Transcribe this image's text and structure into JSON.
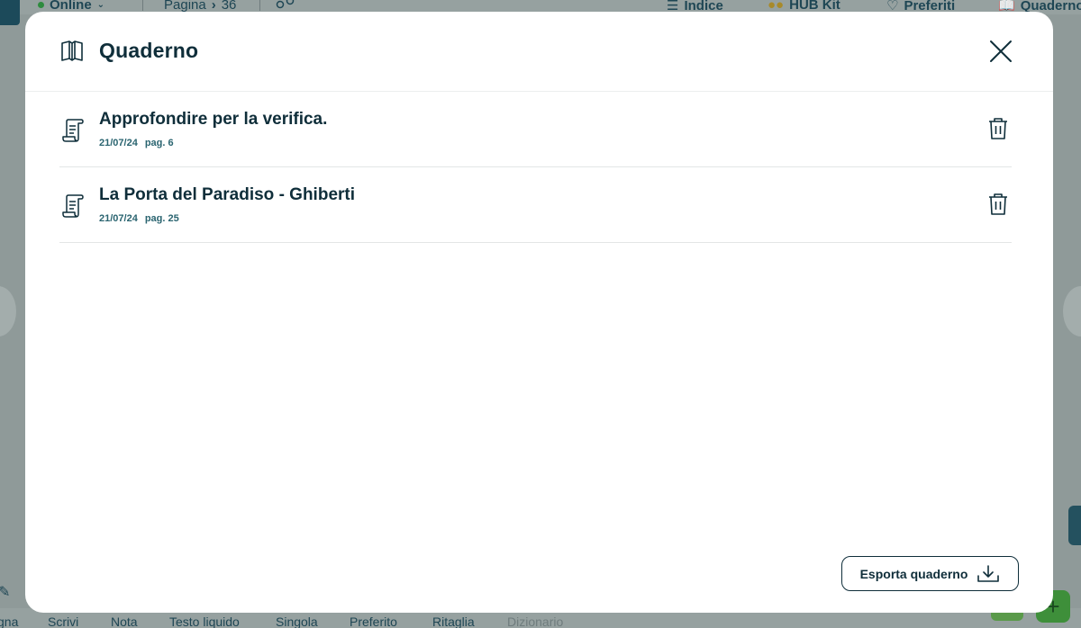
{
  "background": {
    "topbar": {
      "status": "Online",
      "page_label": "Pagina",
      "page_number": "36",
      "index_label": "Indice",
      "hubkit_label": "HUB Kit",
      "favorites_label": "Preferiti",
      "notebook_label": "Quaderno"
    },
    "bottombar": {
      "items": [
        "gna",
        "Scrivi",
        "Nota",
        "Testo liquido",
        "Singola",
        "Preferito",
        "Ritaglia",
        "Dizionario"
      ]
    }
  },
  "modal": {
    "title": "Quaderno",
    "notes": [
      {
        "title": "Approfondire per la verifica.",
        "date": "21/07/24",
        "page": "pag. 6"
      },
      {
        "title": "La Porta del Paradiso - Ghiberti",
        "date": "21/07/24",
        "page": "pag. 25"
      }
    ],
    "export_label": "Esporta quaderno"
  },
  "colors": {
    "primary": "#0f2e3a",
    "meta": "#2a6470",
    "overlay": "#8f9a99",
    "divider": "#e3e6e6"
  },
  "icons": {
    "header": "open-book-icon",
    "note": "scroll-note-icon",
    "close": "close-icon",
    "delete": "trash-icon",
    "export": "download-icon"
  }
}
